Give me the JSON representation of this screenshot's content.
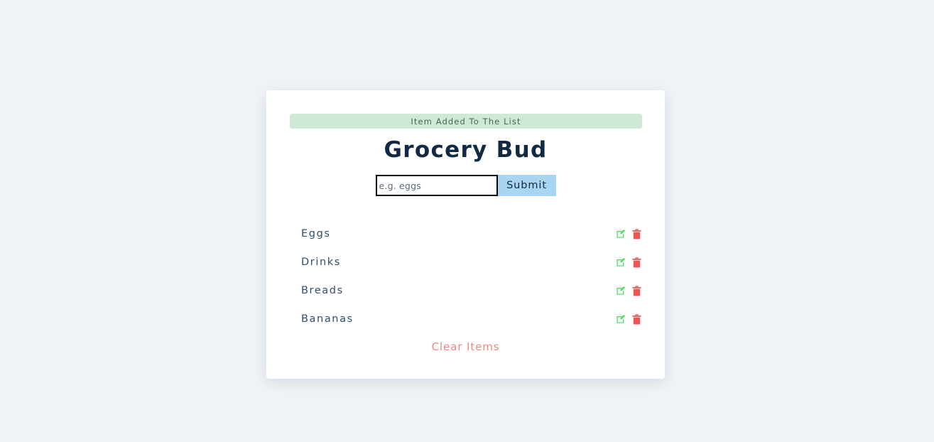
{
  "page": {
    "background_color": "#eff3f7"
  },
  "card": {
    "background_color": "#ffffff"
  },
  "alert": {
    "message": "Item Added To The List",
    "background_color": "#cfe8d7",
    "text_color": "#44674f"
  },
  "header": {
    "title": "Grocery Bud",
    "title_color": "#102a43"
  },
  "form": {
    "input": {
      "value": "",
      "placeholder": "e.g. eggs",
      "focused": true
    },
    "submit": {
      "label": "Submit",
      "background_color": "#a8d5f2"
    }
  },
  "list": {
    "items": [
      {
        "name": "Eggs"
      },
      {
        "name": "Drinks"
      },
      {
        "name": "Breads"
      },
      {
        "name": "Bananas"
      }
    ],
    "icons": {
      "edit": "edit-pencil-square-icon",
      "delete": "trash-can-icon",
      "edit_color": "#4cd964",
      "delete_color": "#ef5350"
    }
  },
  "footer": {
    "clear_label": "Clear Items",
    "clear_color": "#ed8a7e"
  }
}
